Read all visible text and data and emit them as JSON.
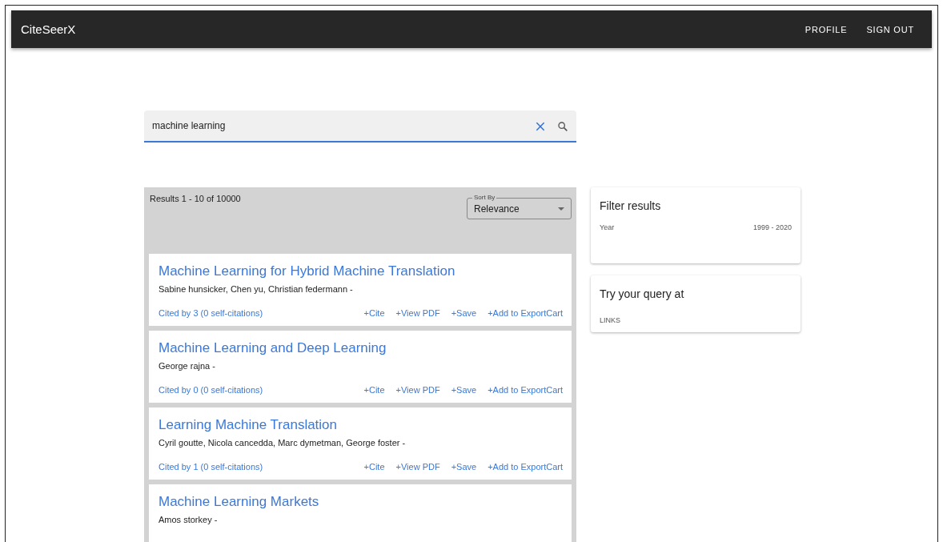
{
  "app_bar": {
    "brand": "CiteSeerX",
    "links": [
      "PROFILE",
      "SIGN OUT"
    ]
  },
  "search": {
    "value": "machine learning"
  },
  "results": {
    "summary": "Results 1 - 10 of 10000",
    "sort": {
      "label": "Sort By",
      "value": "Relevance"
    },
    "items": [
      {
        "title": "Machine Learning for Hybrid Machine Translation",
        "authors": "Sabine hunsicker, Chen yu, Christian federmann -",
        "cited": "Cited by 3 (0 self-citations)",
        "actions": [
          "+Cite",
          "+View PDF",
          "+Save",
          "+Add to ExportCart"
        ]
      },
      {
        "title": "Machine Learning and Deep Learning",
        "authors": "George rajna -",
        "cited": "Cited by 0 (0 self-citations)",
        "actions": [
          "+Cite",
          "+View PDF",
          "+Save",
          "+Add to ExportCart"
        ]
      },
      {
        "title": "Learning Machine Translation",
        "authors": "Cyril goutte, Nicola cancedda, Marc dymetman, George foster -",
        "cited": "Cited by 1 (0 self-citations)",
        "actions": [
          "+Cite",
          "+View PDF",
          "+Save",
          "+Add to ExportCart"
        ]
      },
      {
        "title": "Machine Learning Markets",
        "authors": "Amos storkey -"
      }
    ]
  },
  "filter": {
    "title": "Filter results",
    "label": "Year",
    "value": "1999 - 2020"
  },
  "query_links": {
    "title": "Try your query at",
    "label": "LINKS"
  }
}
